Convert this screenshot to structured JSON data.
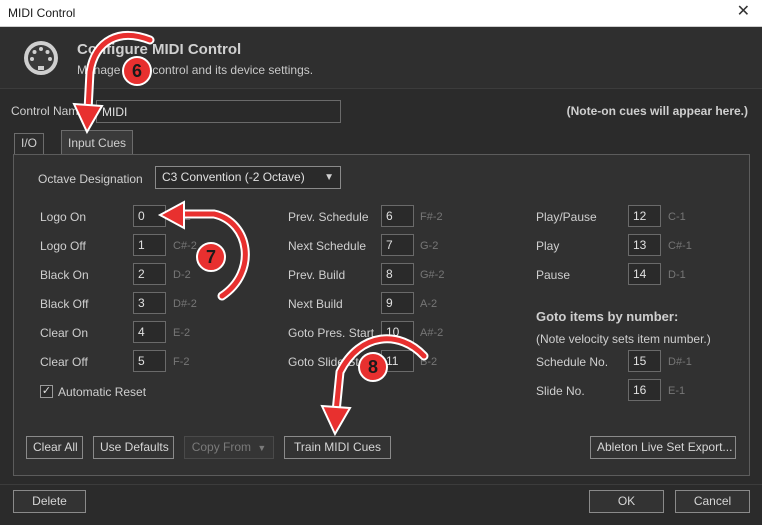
{
  "window": {
    "title": "MIDI Control",
    "close_glyph": "✕"
  },
  "header": {
    "title": "Configure MIDI Control",
    "subtitle": "Manage MIDI control and its device settings."
  },
  "control_name": {
    "label": "Control Name",
    "value": "MIDI"
  },
  "note_hint": "(Note-on cues will appear here.)",
  "tabs": [
    {
      "label": "I/O"
    },
    {
      "label": "Input Cues"
    }
  ],
  "octave": {
    "label": "Octave Designation",
    "value": "C3 Convention (-2 Octave)"
  },
  "cues_col1": [
    {
      "label": "Logo On",
      "value": "0",
      "note": "C-2"
    },
    {
      "label": "Logo Off",
      "value": "1",
      "note": "C#-2"
    },
    {
      "label": "Black On",
      "value": "2",
      "note": "D-2"
    },
    {
      "label": "Black Off",
      "value": "3",
      "note": "D#-2"
    },
    {
      "label": "Clear On",
      "value": "4",
      "note": "E-2"
    },
    {
      "label": "Clear Off",
      "value": "5",
      "note": "F-2"
    }
  ],
  "cues_col2": [
    {
      "label": "Prev. Schedule",
      "value": "6",
      "note": "F#-2"
    },
    {
      "label": "Next Schedule",
      "value": "7",
      "note": "G-2"
    },
    {
      "label": "Prev. Build",
      "value": "8",
      "note": "G#-2"
    },
    {
      "label": "Next Build",
      "value": "9",
      "note": "A-2"
    },
    {
      "label": "Goto Pres. Start",
      "value": "10",
      "note": "A#-2"
    },
    {
      "label": "Goto Slide Start",
      "value": "11",
      "note": "B-2"
    }
  ],
  "cues_col3": [
    {
      "label": "Play/Pause",
      "value": "12",
      "note": "C-1"
    },
    {
      "label": "Play",
      "value": "13",
      "note": "C#-1"
    },
    {
      "label": "Pause",
      "value": "14",
      "note": "D-1"
    }
  ],
  "goto": {
    "heading": "Goto items by number:",
    "subheading": "(Note velocity sets item number.)",
    "items": [
      {
        "label": "Schedule No.",
        "value": "15",
        "note": "D#-1"
      },
      {
        "label": "Slide No.",
        "value": "16",
        "note": "E-1"
      }
    ]
  },
  "automatic_reset": {
    "label": "Automatic Reset",
    "checked": true,
    "glyph": "✓"
  },
  "buttons": {
    "clear_all": "Clear All",
    "use_defaults": "Use Defaults",
    "copy_from": "Copy From",
    "train": "Train MIDI Cues",
    "ableton": "Ableton Live Set Export...",
    "delete": "Delete",
    "ok": "OK",
    "cancel": "Cancel"
  },
  "annotations": [
    {
      "number": "6"
    },
    {
      "number": "7"
    },
    {
      "number": "8"
    }
  ],
  "colors": {
    "annotation_red": "#e8302f",
    "dialog_bg": "#2b2b2b",
    "panel_bg": "#313131",
    "note_text": "#767676"
  },
  "icons": {
    "app": "midi-din-connector-icon",
    "dropdown": "chevron-down-icon",
    "close": "close-icon"
  }
}
